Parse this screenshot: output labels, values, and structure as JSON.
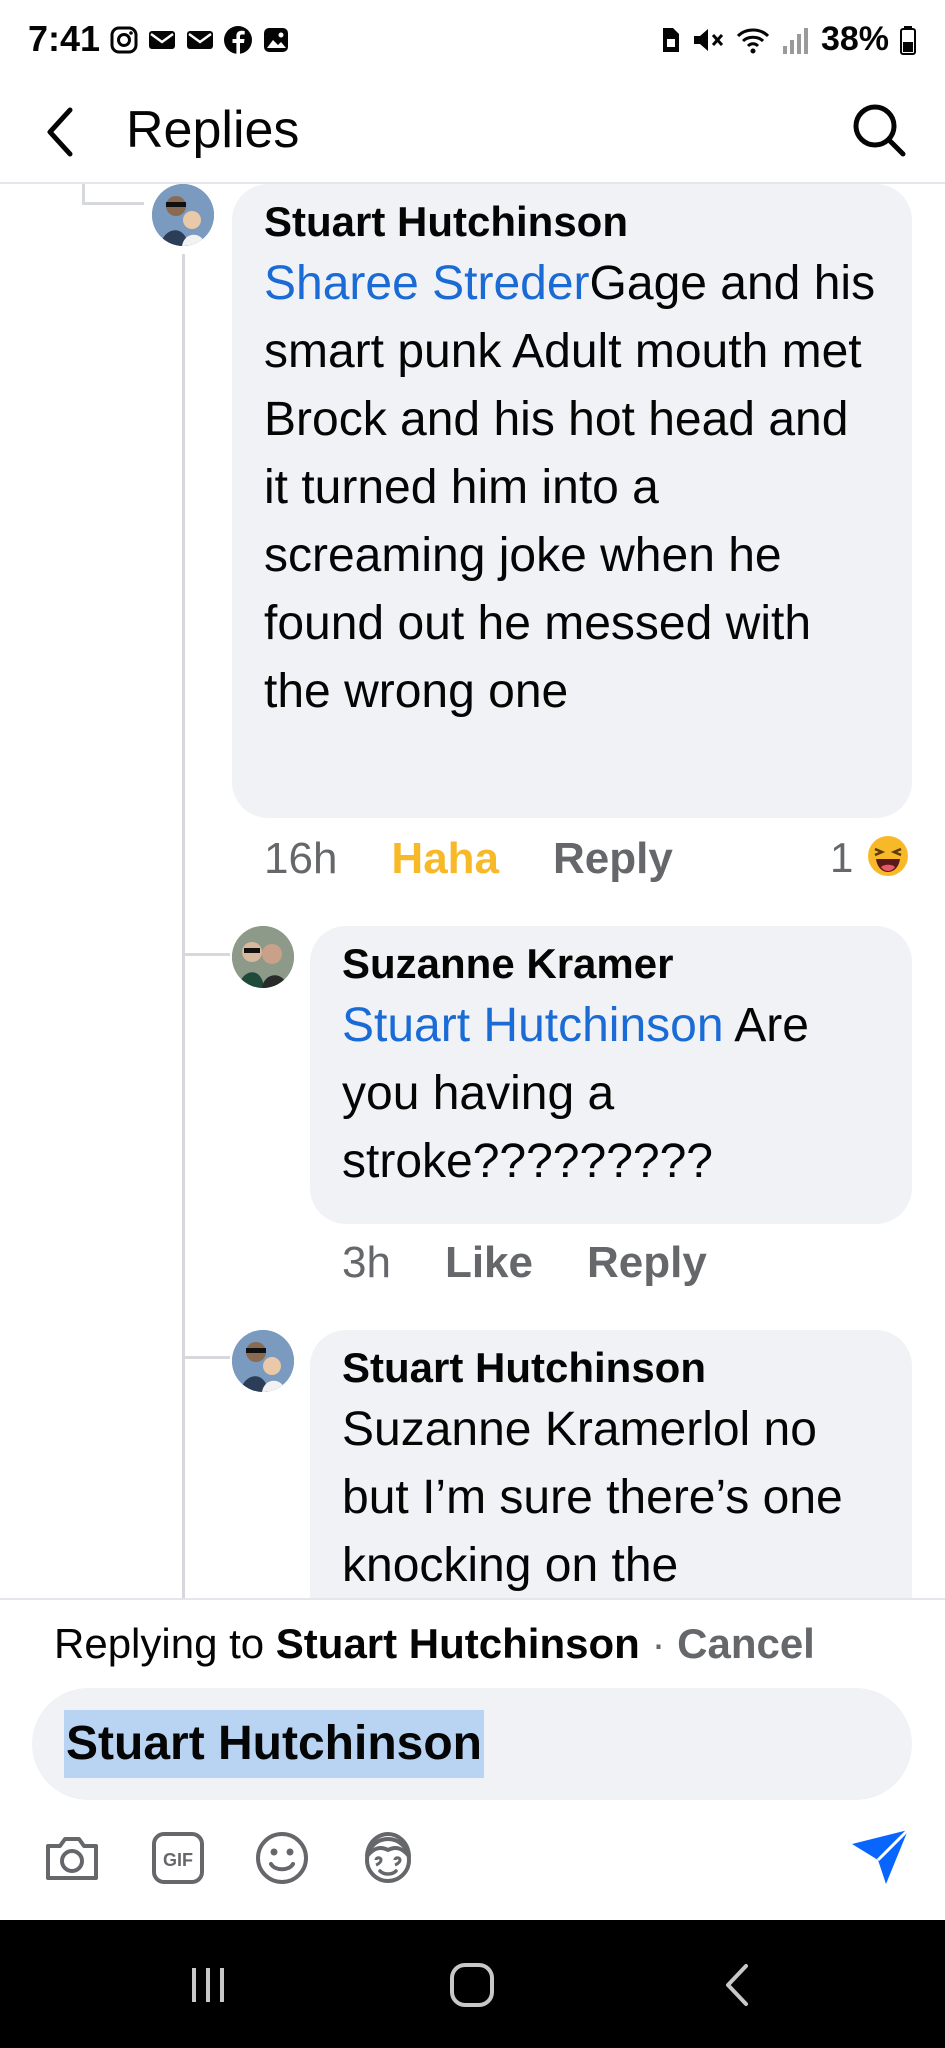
{
  "status_bar": {
    "time": "7:41",
    "battery": "38%"
  },
  "header": {
    "title": "Replies",
    "back_icon": "chevron-left-icon",
    "search_icon": "search-icon"
  },
  "comments": [
    {
      "author": "Stuart Hutchinson",
      "mention": "Sharee Streder",
      "text": "Gage and his smart punk Adult mouth met Brock and his hot head and it turned him into a screaming joke when he found out he messed with the wrong one",
      "time": "16h",
      "reaction_label": "Haha",
      "reply_label": "Reply",
      "reaction_count": "1",
      "reaction_icon": "haha-emoji-icon",
      "reaction_color": "#f7b928"
    },
    {
      "author": "Suzanne Kramer",
      "mention": "Stuart Hutchinson",
      "text": " Are you having a stroke?????????",
      "time": "3h",
      "like_label": "Like",
      "reply_label": "Reply"
    },
    {
      "author": "Stuart Hutchinson",
      "mention_plain": "Suzanne Kramer",
      "text": "lol no but I’m sure there’s one knocking on the"
    }
  ],
  "composer": {
    "replying_prefix": "Replying to ",
    "replying_to": "Stuart Hutchinson",
    "separator": " · ",
    "cancel_label": "Cancel",
    "input_value": "Stuart Hutchinson",
    "tools": [
      "camera-icon",
      "gif-icon",
      "emoji-icon",
      "avatar-sticker-icon"
    ],
    "send_icon": "send-icon",
    "accent": "#0866ff"
  },
  "nav_bar": {
    "buttons": [
      "recents-icon",
      "home-icon",
      "back-icon"
    ]
  }
}
